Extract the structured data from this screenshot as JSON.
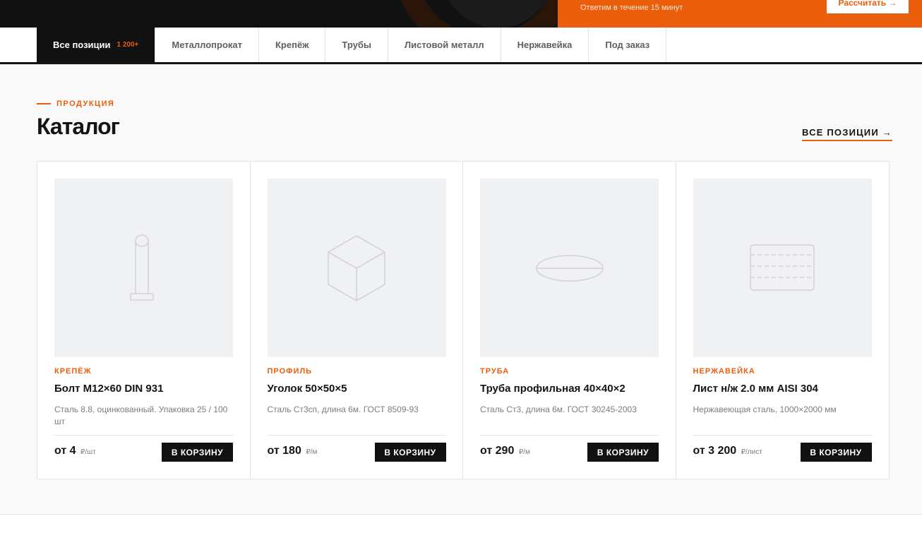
{
  "promo": {
    "subtitle": "Ответим в течение 15 минут",
    "button_label": "Рассчитать →"
  },
  "nav": {
    "tabs": [
      {
        "label": "Все позиции",
        "count": "1 200+"
      },
      {
        "label": "Металлопрокат"
      },
      {
        "label": "Крепёж"
      },
      {
        "label": "Трубы"
      },
      {
        "label": "Листовой металл"
      },
      {
        "label": "Нержавейка"
      },
      {
        "label": "Под заказ"
      }
    ]
  },
  "catalog": {
    "eyebrow": "ПРОДУКЦИЯ",
    "title": "Каталог",
    "all_link": "ВСЕ ПОЗИЦИИ →",
    "cart_label": "В КОРЗИНУ",
    "products": [
      {
        "category": "КРЕПЁЖ",
        "name": "Болт М12×60 DIN 931",
        "desc": "Сталь 8.8, оцинкованный. Упаковка 25 / 100 шт",
        "price": "от 4",
        "unit": "₽/шт",
        "icon": "bolt-icon"
      },
      {
        "category": "ПРОФИЛЬ",
        "name": "Уголок 50×50×5",
        "desc": "Сталь Ст3сп, длина 6м. ГОСТ 8509-93",
        "price": "от 180",
        "unit": "₽/м",
        "icon": "cube-icon"
      },
      {
        "category": "ТРУБА",
        "name": "Труба профильная 40×40×2",
        "desc": "Сталь Ст3, длина 6м. ГОСТ 30245-2003",
        "price": "от 290",
        "unit": "₽/м",
        "icon": "pipe-icon"
      },
      {
        "category": "НЕРЖАВЕЙКА",
        "name": "Лист н/ж 2.0 мм AISI 304",
        "desc": "Нержавеющая сталь, 1000×2000 мм",
        "price": "от 3 200",
        "unit": "₽/лист",
        "icon": "sheet-icon"
      }
    ]
  },
  "colors": {
    "accent": "#ea5e0c",
    "dark": "#111111",
    "section_bg": "#f9f9f9",
    "placeholder_bg": "#f0f1f3"
  }
}
